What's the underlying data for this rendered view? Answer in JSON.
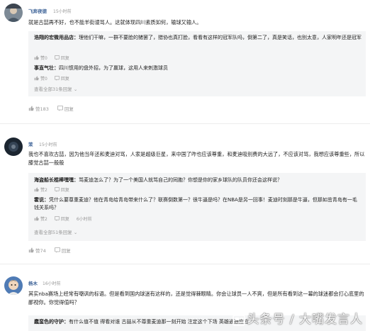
{
  "comments": [
    {
      "username": "飞奔夜德",
      "time": "15小时前",
      "text": "就是古喆再不好，也不能羊街谩骂人。这就体现四川素质如何，输球又输人。",
      "replies": [
        {
          "name": "浩翔的宏微用品店：",
          "text": "理他们干嘛，一群不要脸的猪罢了，猎协也真打脸，看看有这样的冠军队吗，倒第二了，真是笑话，也别太意，人家明年还是冠军"
        },
        {
          "name": "事直气壮：",
          "text": "四川惯用的盘外招，为了赢球，这用人来刺激球员"
        }
      ],
      "reply_likes": "赞0",
      "reply_label": "回复",
      "view_all": "查看全部31条回复",
      "likes": "赞183",
      "reply_action": "回复"
    },
    {
      "username": "茉",
      "time": "15小时前",
      "text": "我也不喜欢古喆，因为他当年还和麦迪对骂，人家是超级巨星，来中国了咋也应该尊重，和麦迪吸别费的大远了，不应该对骂，我想应该尊重些，所以膝觉古喆一般般",
      "replies": [
        {
          "name": "海盗船长棍棒嘿嘿：",
          "text": "骂麦迪怎么了？为了一个美国人就骂自己的同胞？你想是你的家乡球队的队员你还会这样说？"
        },
        {
          "name": "霍说：",
          "text": "凭什么要尊重麦迪？他在青岛给青岛带来什么了？联赛倒数第一？很牛逼是吗？在NBA是另一回事！麦迪时刻那是牛逼，但那如茁青岛有一毛钱关系吗？"
        }
      ],
      "reply_likes": "赞2",
      "reply_label": "回复",
      "reply_time": "6小时前",
      "view_all": "查看全部51条回复",
      "likes": "赞74",
      "reply_action": "回复"
    },
    {
      "username": "杨木",
      "time": "16小时前",
      "text": "其实nba赛场上经常有嘲讽的标语。但是看到国内球迷有这样的，还是觉得棘眼睛。你会让球员一人不爽，但是所有看到这一幕的球迷都会打心底里的鄙视你。你觉得值吗？",
      "replies": [
        {
          "name": "蠢蛮色的守护：",
          "text": "有什么值不值 得看对谁 古喆从不尊重麦迪那一刻开始 注定这个下场 英雄通通应应"
        }
      ]
    }
  ],
  "watermark": "头条号 / 大嘴发言人"
}
